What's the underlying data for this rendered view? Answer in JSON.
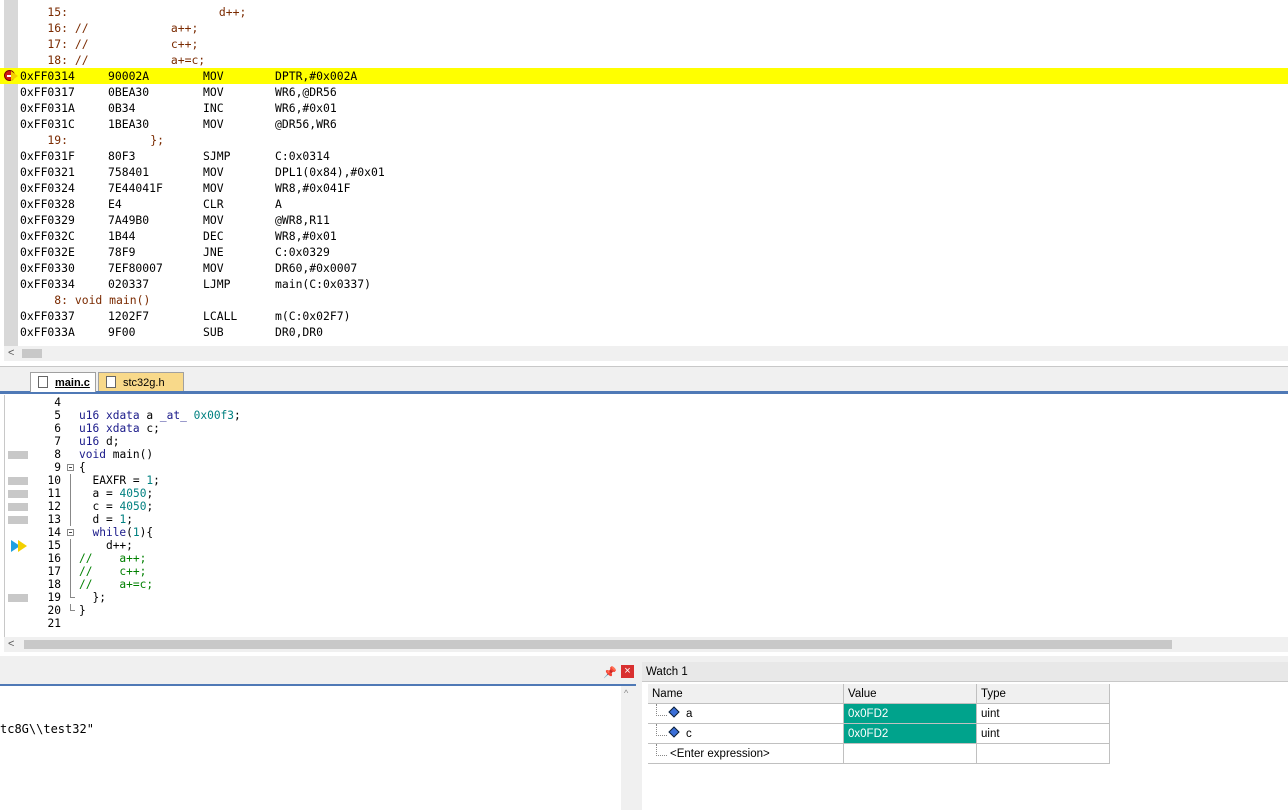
{
  "disassembly": {
    "lines": [
      {
        "kind": "src",
        "text": "    15:                      d++;"
      },
      {
        "kind": "src",
        "text": "    16: //            a++;"
      },
      {
        "kind": "src",
        "text": "    17: //            c++;"
      },
      {
        "kind": "src",
        "text": "    18: //            a+=c;"
      },
      {
        "kind": "asm",
        "addr": "0xFF0314",
        "opcode": "90002A",
        "mnemonic": "MOV",
        "operands": "DPTR,#0x002A",
        "current": true
      },
      {
        "kind": "asm",
        "addr": "0xFF0317",
        "opcode": "0BEA30",
        "mnemonic": "MOV",
        "operands": "WR6,@DR56"
      },
      {
        "kind": "asm",
        "addr": "0xFF031A",
        "opcode": "0B34",
        "mnemonic": "INC",
        "operands": "WR6,#0x01"
      },
      {
        "kind": "asm",
        "addr": "0xFF031C",
        "opcode": "1BEA30",
        "mnemonic": "MOV",
        "operands": "@DR56,WR6"
      },
      {
        "kind": "src",
        "text": "    19:            };"
      },
      {
        "kind": "asm",
        "addr": "0xFF031F",
        "opcode": "80F3",
        "mnemonic": "SJMP",
        "operands": "C:0x0314"
      },
      {
        "kind": "asm",
        "addr": "0xFF0321",
        "opcode": "758401",
        "mnemonic": "MOV",
        "operands": "DPL1(0x84),#0x01"
      },
      {
        "kind": "asm",
        "addr": "0xFF0324",
        "opcode": "7E44041F",
        "mnemonic": "MOV",
        "operands": "WR8,#0x041F"
      },
      {
        "kind": "asm",
        "addr": "0xFF0328",
        "opcode": "E4",
        "mnemonic": "CLR",
        "operands": "A"
      },
      {
        "kind": "asm",
        "addr": "0xFF0329",
        "opcode": "7A49B0",
        "mnemonic": "MOV",
        "operands": "@WR8,R11"
      },
      {
        "kind": "asm",
        "addr": "0xFF032C",
        "opcode": "1B44",
        "mnemonic": "DEC",
        "operands": "WR8,#0x01"
      },
      {
        "kind": "asm",
        "addr": "0xFF032E",
        "opcode": "78F9",
        "mnemonic": "JNE",
        "operands": "C:0x0329"
      },
      {
        "kind": "asm",
        "addr": "0xFF0330",
        "opcode": "7EF80007",
        "mnemonic": "MOV",
        "operands": "DR60,#0x0007"
      },
      {
        "kind": "asm",
        "addr": "0xFF0334",
        "opcode": "020337",
        "mnemonic": "LJMP",
        "operands": "main(C:0x0337)"
      },
      {
        "kind": "src",
        "text": "     8: void main()"
      },
      {
        "kind": "asm",
        "addr": "0xFF0337",
        "opcode": "1202F7",
        "mnemonic": "LCALL",
        "operands": "m(C:0x02F7)"
      },
      {
        "kind": "asm",
        "addr": "0xFF033A",
        "opcode": "9F00",
        "mnemonic": "SUB",
        "operands": "DR0,DR0"
      }
    ]
  },
  "tabs": [
    {
      "label": "main.c",
      "active": true
    },
    {
      "label": "stc32g.h",
      "active": false
    }
  ],
  "editor": {
    "lines": [
      {
        "n": "4",
        "html": ""
      },
      {
        "n": "5",
        "code": "u16 xdata a _at_ 0x00f3;"
      },
      {
        "n": "6",
        "code": "u16 xdata c;"
      },
      {
        "n": "7",
        "code": "u16 d;"
      },
      {
        "n": "8",
        "code": "void main()",
        "mark": true
      },
      {
        "n": "9",
        "code": "{",
        "fold": "open"
      },
      {
        "n": "10",
        "code": "  EAXFR = 1;",
        "mark": true,
        "line": true
      },
      {
        "n": "11",
        "code": "  a = 4050;",
        "mark": true,
        "line": true
      },
      {
        "n": "12",
        "code": "  c = 4050;",
        "mark": true,
        "line": true
      },
      {
        "n": "13",
        "code": "  d = 1;",
        "mark": true,
        "line": true
      },
      {
        "n": "14",
        "code": "  while(1){",
        "fold": "open2"
      },
      {
        "n": "15",
        "code": "    d++;",
        "current": true,
        "line": true
      },
      {
        "n": "16",
        "code": "//    a++;",
        "comment": true,
        "line": true
      },
      {
        "n": "17",
        "code": "//    c++;",
        "comment": true,
        "line": true
      },
      {
        "n": "18",
        "code": "//    a+=c;",
        "comment": true,
        "line": true
      },
      {
        "n": "19",
        "code": "  };",
        "mark": true,
        "fold": "end"
      },
      {
        "n": "20",
        "code": "}",
        "fold": "end"
      },
      {
        "n": "21",
        "code": ""
      }
    ]
  },
  "output": {
    "text": "tc8G\\\\test32\"",
    "pin_icon": "📌",
    "close_label": "×"
  },
  "watch": {
    "title": "Watch 1",
    "headers": [
      "Name",
      "Value",
      "Type"
    ],
    "rows": [
      {
        "name": "a",
        "value": "0x0FD2",
        "type": "uint"
      },
      {
        "name": "c",
        "value": "0x0FD2",
        "type": "uint"
      }
    ],
    "enter_expression": "<Enter expression>"
  }
}
